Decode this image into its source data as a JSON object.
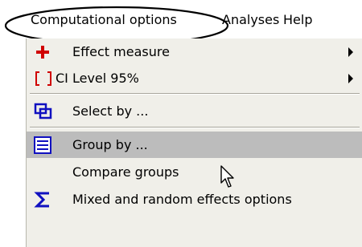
{
  "menubar": {
    "items": [
      {
        "label": "Computational options"
      },
      {
        "label": "Analyses"
      },
      {
        "label": "Help"
      }
    ]
  },
  "menu": {
    "items": [
      {
        "label": "Effect measure",
        "icon": "plus-icon",
        "submenu": true
      },
      {
        "label": "CI Level  95%",
        "icon": "brackets-icon",
        "submenu": true
      },
      {
        "label": "Select by ...",
        "icon": "select-icon",
        "submenu": false
      },
      {
        "label": "Group by ...",
        "icon": "group-icon",
        "submenu": false,
        "highlighted": true
      },
      {
        "label": "Compare groups",
        "icon": "",
        "submenu": false
      },
      {
        "label": "Mixed and random effects options",
        "icon": "sigma-icon",
        "submenu": false
      }
    ]
  },
  "colors": {
    "menu_background": "#f0efe9",
    "highlight": "#bcbcbc",
    "icon_red": "#d00000",
    "icon_blue": "#1010c0"
  }
}
